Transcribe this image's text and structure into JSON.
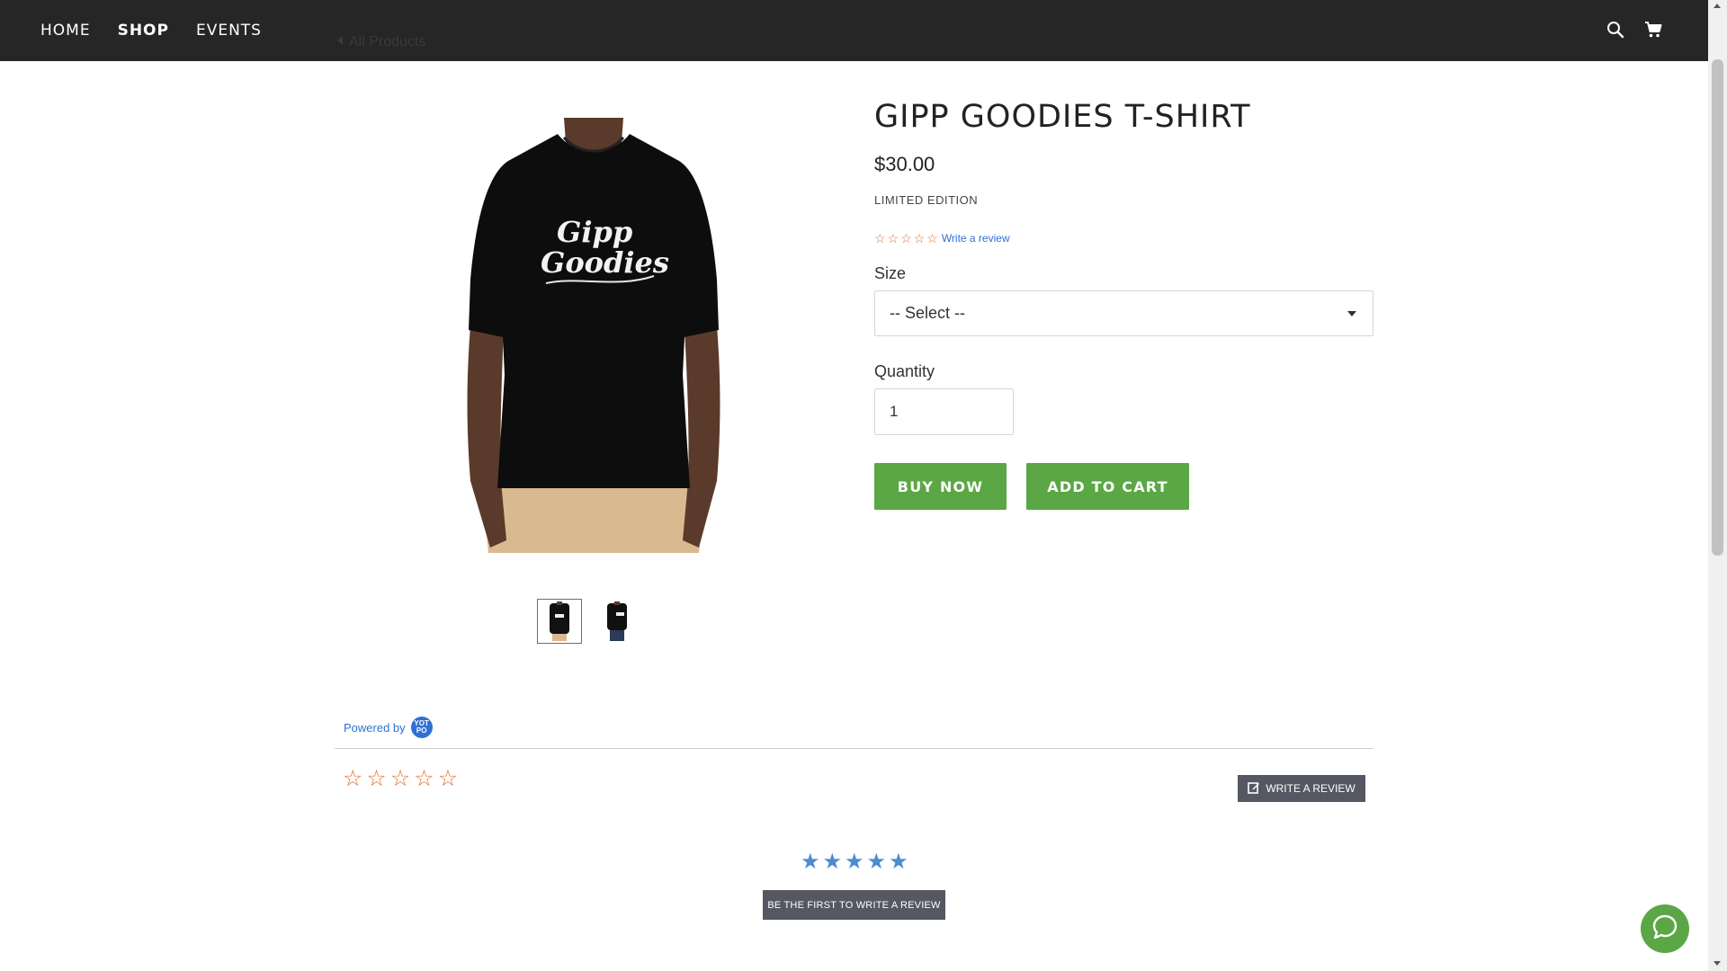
{
  "nav": {
    "items": [
      {
        "label": "HOME",
        "active": false
      },
      {
        "label": "SHOP",
        "active": true
      },
      {
        "label": "EVENTS",
        "active": false
      }
    ],
    "icons": [
      "search-icon",
      "cart-icon"
    ]
  },
  "breadcrumb": {
    "back_label": "All Products"
  },
  "product": {
    "title": "GIPP GOODIES T-SHIRT",
    "price": "$30.00",
    "edition": "LIMITED EDITION",
    "image_text": "Gipp Goodies",
    "rating": 0,
    "review_link": "Write a review",
    "size_label": "Size",
    "size_selected": "-- Select --",
    "quantity_label": "Quantity",
    "quantity_value": "1",
    "buy_now_label": "BUY NOW",
    "add_to_cart_label": "ADD TO CART",
    "thumbnail_count": 2
  },
  "reviews": {
    "powered_by": "Powered by",
    "logo_text": "YOT PO",
    "average_rating": 0,
    "write_review_label": "WRITE A REVIEW",
    "first_review_label": "BE THE FIRST TO WRITE A REVIEW"
  },
  "colors": {
    "header_bg": "#262626",
    "button_green": "#5ba745",
    "star_orange": "#e46f2a",
    "star_blue": "#4b8bd1",
    "review_button_bg": "#555862",
    "link_blue": "#2f6fd6"
  }
}
